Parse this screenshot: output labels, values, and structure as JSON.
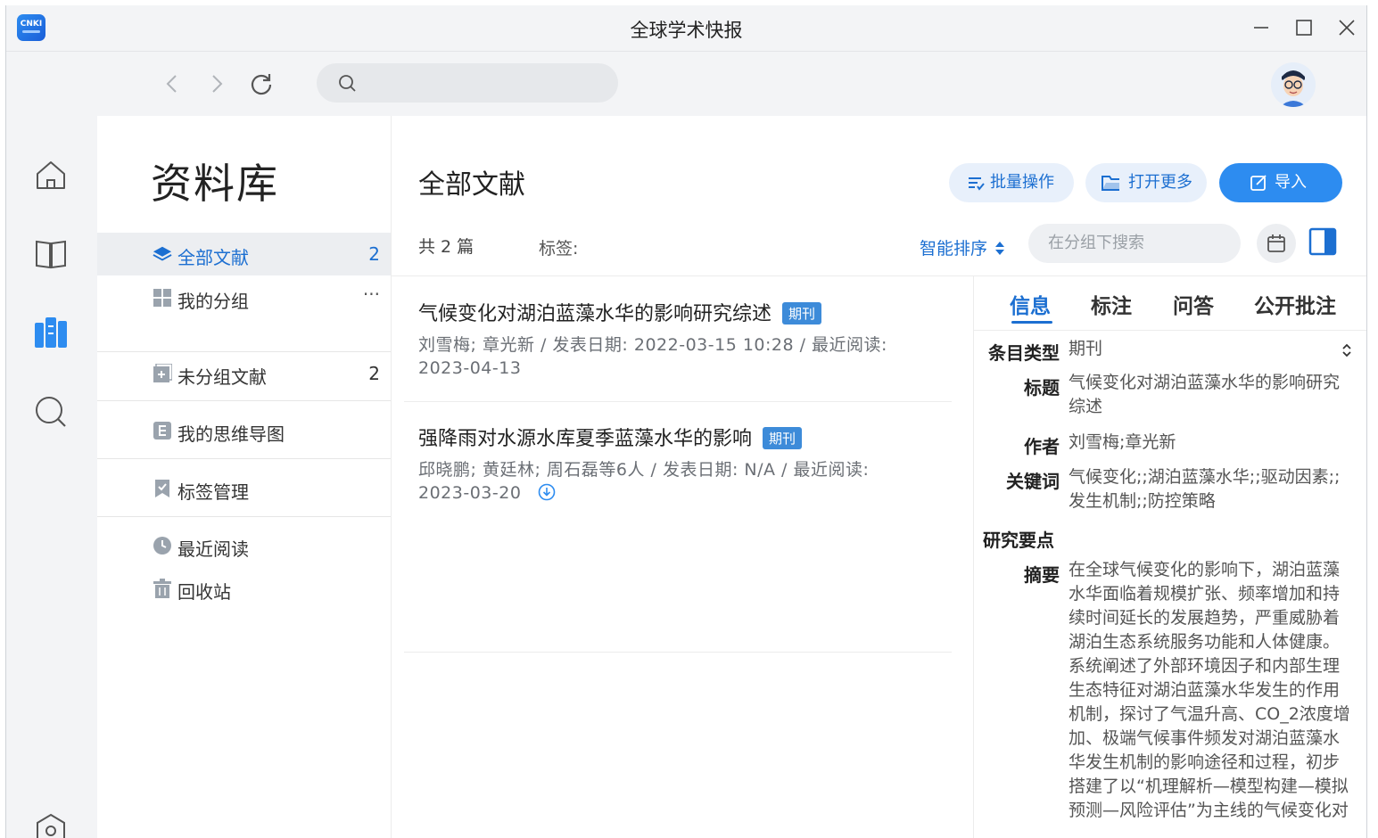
{
  "window": {
    "title": "全球学术快报",
    "logo_text": "CNKI"
  },
  "library": {
    "title": "资料库",
    "items": [
      {
        "label": "全部文献",
        "count": "2"
      },
      {
        "label": "我的分组",
        "more": "···"
      },
      {
        "label": "未分组文献",
        "count": "2"
      },
      {
        "label": "我的思维导图"
      },
      {
        "label": "标签管理"
      },
      {
        "label": "最近阅读"
      },
      {
        "label": "回收站"
      }
    ]
  },
  "main": {
    "title": "全部文献",
    "actions": {
      "batch": "批量操作",
      "open_more": "打开更多",
      "import": "导入"
    },
    "count_text": "共 2 篇",
    "tags_label": "标签:",
    "sort_label": "智能排序",
    "search_placeholder": "在分组下搜索",
    "documents": [
      {
        "title": "气候变化对湖泊蓝藻水华的影响研究综述",
        "badge": "期刊",
        "meta_line1": "刘雪梅; 章光新 / 发表日期: 2022-03-15 10:28 / 最近阅读:",
        "meta_line2": "2023-04-13"
      },
      {
        "title": "强降雨对水源水库夏季蓝藻水华的影响",
        "badge": "期刊",
        "meta_line1": "邱晓鹏; 黄廷林; 周石磊等6人 / 发表日期: N/A / 最近阅读:",
        "meta_line2": "2023-03-20"
      }
    ]
  },
  "detail": {
    "tabs": [
      "信息",
      "标注",
      "问答",
      "公开批注"
    ],
    "fields": {
      "type_key": "条目类型",
      "type_value": "期刊",
      "title_key": "标题",
      "title_value": "气候变化对湖泊蓝藻水华的影响研究综述",
      "author_key": "作者",
      "author_value": "刘雪梅;章光新",
      "keywords_key": "关键词",
      "keywords_value": "气候变化;;湖泊蓝藻水华;;驱动因素;;发生机制;;防控策略",
      "section": "研究要点",
      "abstract_key": "摘要",
      "abstract_value": "在全球气候变化的影响下，湖泊蓝藻水华面临着规模扩张、频率增加和持续时间延长的发展趋势，严重威胁着湖泊生态系统服务功能和人体健康。系统阐述了外部环境因子和内部生理生态特征对湖泊蓝藻水华发生的作用机制，探讨了气温升高、CO_2浓度增加、极端气候事件频发对湖泊蓝藻水华发生机制的影响途径和过程，初步搭建了以“机理解析—模型构建—模拟预测—风险评估”为主线的气候变化对"
    }
  }
}
